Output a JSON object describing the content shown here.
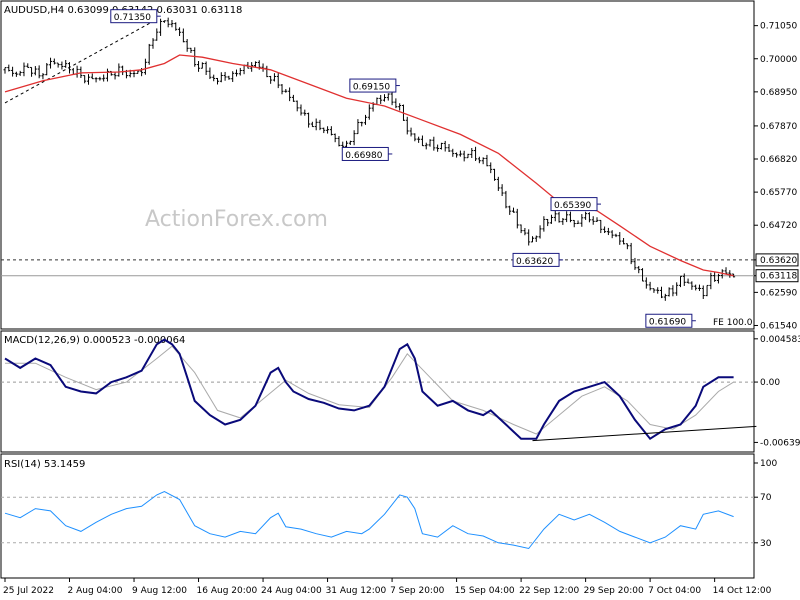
{
  "chart_data": [
    {
      "type": "candlestick",
      "panel": "price",
      "header": "AUDUSD,H4  0.63099 0.63142 0.63031 0.63118",
      "watermark": "ActionForex.com",
      "ylim": [
        0.6146,
        0.718
      ],
      "yticks": [
        0.7105,
        0.7,
        0.6895,
        0.6787,
        0.6682,
        0.6577,
        0.6472,
        0.6259,
        0.6154
      ],
      "ytick_labels": [
        "0.71050",
        "0.70000",
        "0.68950",
        "0.67870",
        "0.66820",
        "0.65770",
        "0.64720",
        "0.62590",
        "0.61540"
      ],
      "close_series": [
        [
          0,
          0.6965
        ],
        [
          3,
          0.6952
        ],
        [
          6,
          0.6975
        ],
        [
          9,
          0.6945
        ],
        [
          12,
          0.699
        ],
        [
          15,
          0.698
        ],
        [
          18,
          0.6962
        ],
        [
          21,
          0.6938
        ],
        [
          24,
          0.6935
        ],
        [
          27,
          0.6948
        ],
        [
          30,
          0.6962
        ],
        [
          33,
          0.695
        ],
        [
          36,
          0.696
        ],
        [
          38,
          0.703
        ],
        [
          40,
          0.7095
        ],
        [
          42,
          0.712
        ],
        [
          44,
          0.711
        ],
        [
          46,
          0.7078
        ],
        [
          48,
          0.704
        ],
        [
          50,
          0.6985
        ],
        [
          52,
          0.6975
        ],
        [
          54,
          0.6945
        ],
        [
          56,
          0.693
        ],
        [
          58,
          0.6948
        ],
        [
          60,
          0.694
        ],
        [
          62,
          0.6972
        ],
        [
          64,
          0.697
        ],
        [
          66,
          0.699
        ],
        [
          68,
          0.696
        ],
        [
          70,
          0.694
        ],
        [
          72,
          0.692
        ],
        [
          74,
          0.689
        ],
        [
          76,
          0.6865
        ],
        [
          78,
          0.683
        ],
        [
          80,
          0.68
        ],
        [
          82,
          0.6785
        ],
        [
          84,
          0.678
        ],
        [
          86,
          0.676
        ],
        [
          88,
          0.673
        ],
        [
          90,
          0.672
        ],
        [
          92,
          0.677
        ],
        [
          94,
          0.68
        ],
        [
          96,
          0.684
        ],
        [
          98,
          0.687
        ],
        [
          100,
          0.688
        ],
        [
          102,
          0.687
        ],
        [
          104,
          0.684
        ],
        [
          106,
          0.6775
        ],
        [
          108,
          0.6745
        ],
        [
          110,
          0.6732
        ],
        [
          112,
          0.6728
        ],
        [
          114,
          0.6722
        ],
        [
          116,
          0.672
        ],
        [
          118,
          0.67
        ],
        [
          120,
          0.669
        ],
        [
          122,
          0.67
        ],
        [
          124,
          0.669
        ],
        [
          126,
          0.6675
        ],
        [
          128,
          0.665
        ],
        [
          130,
          0.659
        ],
        [
          132,
          0.654
        ],
        [
          134,
          0.65
        ],
        [
          136,
          0.646
        ],
        [
          138,
          0.642
        ],
        [
          140,
          0.644
        ],
        [
          142,
          0.648
        ],
        [
          144,
          0.65
        ],
        [
          146,
          0.649
        ],
        [
          148,
          0.65
        ],
        [
          150,
          0.6475
        ],
        [
          152,
          0.6495
        ],
        [
          154,
          0.65
        ],
        [
          156,
          0.6475
        ],
        [
          158,
          0.6455
        ],
        [
          160,
          0.644
        ],
        [
          162,
          0.643
        ],
        [
          164,
          0.6395
        ],
        [
          166,
          0.634
        ],
        [
          168,
          0.63
        ],
        [
          170,
          0.627
        ],
        [
          172,
          0.626
        ],
        [
          174,
          0.6248
        ],
        [
          176,
          0.6268
        ],
        [
          178,
          0.63
        ],
        [
          180,
          0.629
        ],
        [
          182,
          0.627
        ],
        [
          184,
          0.626
        ],
        [
          186,
          0.63
        ],
        [
          188,
          0.6315
        ],
        [
          190,
          0.6323
        ],
        [
          192,
          0.6312
        ]
      ],
      "ma_series": [
        [
          0,
          0.6895
        ],
        [
          10,
          0.693
        ],
        [
          20,
          0.6955
        ],
        [
          30,
          0.6958
        ],
        [
          36,
          0.6965
        ],
        [
          42,
          0.6985
        ],
        [
          46,
          0.7012
        ],
        [
          52,
          0.7005
        ],
        [
          60,
          0.6985
        ],
        [
          70,
          0.6965
        ],
        [
          80,
          0.692
        ],
        [
          90,
          0.6875
        ],
        [
          100,
          0.685
        ],
        [
          110,
          0.6805
        ],
        [
          120,
          0.676
        ],
        [
          130,
          0.67
        ],
        [
          140,
          0.6605
        ],
        [
          146,
          0.6545
        ],
        [
          150,
          0.653
        ],
        [
          156,
          0.6518
        ],
        [
          162,
          0.647
        ],
        [
          170,
          0.6405
        ],
        [
          178,
          0.636
        ],
        [
          184,
          0.633
        ],
        [
          188,
          0.6322
        ],
        [
          192,
          0.6312
        ]
      ],
      "levels": [
        {
          "value": 0.6362,
          "style": "dashed",
          "label": "0.63620"
        },
        {
          "value": 0.63118,
          "style": "solid",
          "label": "0.63118"
        }
      ],
      "swing_labels": [
        {
          "text": "0.71350",
          "i": 40,
          "value": 0.7135
        },
        {
          "text": "0.69150",
          "i": 103,
          "value": 0.6915
        },
        {
          "text": "0.66980",
          "i": 101,
          "value": 0.6698
        },
        {
          "text": "0.65390",
          "i": 156,
          "value": 0.6539
        },
        {
          "text": "0.63620",
          "i": 146,
          "value": 0.6362
        },
        {
          "text": "0.61690",
          "i": 181,
          "value": 0.6169
        }
      ],
      "annotations": [
        "FE 100.0"
      ],
      "trendline": {
        "from": [
          0,
          0.686
        ],
        "to": [
          40,
          0.7125
        ]
      }
    },
    {
      "type": "line",
      "panel": "macd",
      "header": "MACD(12,26,9) 0.000523 -0.000064",
      "ylim": [
        -0.0072,
        0.0052
      ],
      "ytick_labels": [
        "0.004583",
        "0.00",
        "-0.006397"
      ],
      "yticks": [
        0.004583,
        0.0,
        -0.006397
      ],
      "macd": [
        [
          0,
          0.0025
        ],
        [
          4,
          0.0015
        ],
        [
          8,
          0.0025
        ],
        [
          12,
          0.0018
        ],
        [
          16,
          -0.0005
        ],
        [
          20,
          -0.001
        ],
        [
          24,
          -0.0012
        ],
        [
          28,
          0.0
        ],
        [
          32,
          0.0005
        ],
        [
          36,
          0.0012
        ],
        [
          40,
          0.004
        ],
        [
          42,
          0.0045
        ],
        [
          44,
          0.004
        ],
        [
          46,
          0.003
        ],
        [
          48,
          0.0005
        ],
        [
          50,
          -0.002
        ],
        [
          54,
          -0.0035
        ],
        [
          58,
          -0.0045
        ],
        [
          62,
          -0.004
        ],
        [
          66,
          -0.0025
        ],
        [
          70,
          0.001
        ],
        [
          72,
          0.0015
        ],
        [
          74,
          0.0
        ],
        [
          76,
          -0.001
        ],
        [
          80,
          -0.0018
        ],
        [
          84,
          -0.0022
        ],
        [
          88,
          -0.0028
        ],
        [
          92,
          -0.003
        ],
        [
          96,
          -0.0025
        ],
        [
          100,
          -0.0005
        ],
        [
          104,
          0.0035
        ],
        [
          106,
          0.004
        ],
        [
          108,
          0.0025
        ],
        [
          110,
          -0.001
        ],
        [
          114,
          -0.0025
        ],
        [
          118,
          -0.002
        ],
        [
          122,
          -0.003
        ],
        [
          126,
          -0.0035
        ],
        [
          128,
          -0.003
        ],
        [
          132,
          -0.0045
        ],
        [
          136,
          -0.006
        ],
        [
          140,
          -0.006
        ],
        [
          142,
          -0.0045
        ],
        [
          146,
          -0.002
        ],
        [
          150,
          -0.001
        ],
        [
          154,
          -0.0005
        ],
        [
          158,
          0.0
        ],
        [
          162,
          -0.0015
        ],
        [
          166,
          -0.004
        ],
        [
          170,
          -0.006
        ],
        [
          174,
          -0.005
        ],
        [
          178,
          -0.0045
        ],
        [
          182,
          -0.0025
        ],
        [
          184,
          -0.0005
        ],
        [
          188,
          0.0005
        ],
        [
          192,
          0.0005
        ]
      ],
      "signal": [
        [
          0,
          0.002
        ],
        [
          8,
          0.002
        ],
        [
          16,
          0.0005
        ],
        [
          24,
          -0.0008
        ],
        [
          32,
          0.0
        ],
        [
          40,
          0.0025
        ],
        [
          44,
          0.0038
        ],
        [
          50,
          0.001
        ],
        [
          56,
          -0.003
        ],
        [
          62,
          -0.0038
        ],
        [
          68,
          -0.0018
        ],
        [
          74,
          0.0002
        ],
        [
          80,
          -0.0012
        ],
        [
          88,
          -0.0024
        ],
        [
          96,
          -0.0027
        ],
        [
          102,
          0.0005
        ],
        [
          106,
          0.003
        ],
        [
          112,
          0.0005
        ],
        [
          118,
          -0.002
        ],
        [
          126,
          -0.003
        ],
        [
          134,
          -0.0045
        ],
        [
          140,
          -0.0055
        ],
        [
          146,
          -0.0035
        ],
        [
          152,
          -0.0015
        ],
        [
          158,
          -0.0005
        ],
        [
          164,
          -0.002
        ],
        [
          170,
          -0.0045
        ],
        [
          176,
          -0.005
        ],
        [
          182,
          -0.0035
        ],
        [
          188,
          -0.001
        ],
        [
          192,
          0.0
        ]
      ],
      "trendline": {
        "from": [
          139,
          -0.0062
        ],
        "to": [
          198,
          -0.0047
        ]
      }
    },
    {
      "type": "line",
      "panel": "rsi",
      "header": "RSI(14) 53.1459",
      "ylim": [
        0,
        100
      ],
      "yticks": [
        100,
        70,
        30
      ],
      "ytick_labels": [
        "100",
        "70",
        "30"
      ],
      "rsi": [
        [
          0,
          56
        ],
        [
          4,
          52
        ],
        [
          8,
          60
        ],
        [
          12,
          58
        ],
        [
          16,
          45
        ],
        [
          20,
          40
        ],
        [
          24,
          48
        ],
        [
          28,
          55
        ],
        [
          32,
          60
        ],
        [
          36,
          62
        ],
        [
          40,
          72
        ],
        [
          42,
          75
        ],
        [
          46,
          68
        ],
        [
          50,
          45
        ],
        [
          54,
          38
        ],
        [
          58,
          35
        ],
        [
          62,
          40
        ],
        [
          66,
          38
        ],
        [
          70,
          52
        ],
        [
          72,
          56
        ],
        [
          74,
          44
        ],
        [
          78,
          42
        ],
        [
          82,
          38
        ],
        [
          86,
          35
        ],
        [
          90,
          40
        ],
        [
          94,
          38
        ],
        [
          96,
          42
        ],
        [
          100,
          55
        ],
        [
          104,
          72
        ],
        [
          106,
          70
        ],
        [
          108,
          60
        ],
        [
          110,
          38
        ],
        [
          114,
          35
        ],
        [
          118,
          45
        ],
        [
          122,
          38
        ],
        [
          126,
          36
        ],
        [
          130,
          30
        ],
        [
          134,
          28
        ],
        [
          138,
          25
        ],
        [
          142,
          42
        ],
        [
          146,
          55
        ],
        [
          150,
          50
        ],
        [
          154,
          55
        ],
        [
          158,
          48
        ],
        [
          162,
          40
        ],
        [
          166,
          35
        ],
        [
          170,
          30
        ],
        [
          174,
          35
        ],
        [
          178,
          45
        ],
        [
          182,
          42
        ],
        [
          184,
          55
        ],
        [
          188,
          58
        ],
        [
          192,
          53
        ]
      ]
    }
  ],
  "time_axis": {
    "labels": [
      "25 Jul 2022",
      "2 Aug 04:00",
      "9 Aug 12:00",
      "16 Aug 20:00",
      "24 Aug 04:00",
      "31 Aug 12:00",
      "7 Sep 20:00",
      "15 Sep 04:00",
      "22 Sep 12:00",
      "29 Sep 20:00",
      "7 Oct 04:00",
      "14 Oct 12:00"
    ],
    "label_positions": [
      0,
      17,
      34,
      51,
      68,
      85,
      102,
      119,
      136,
      153,
      170,
      187
    ]
  }
}
